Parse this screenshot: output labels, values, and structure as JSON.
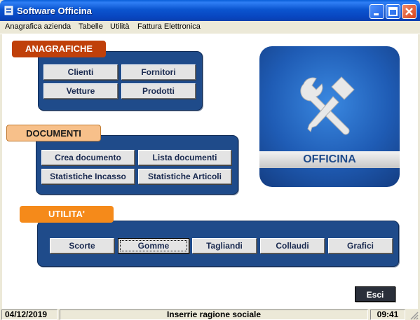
{
  "window": {
    "title": "Software Officina"
  },
  "menu": {
    "items": [
      "Anagrafica azienda",
      "Tabelle",
      "Utilità",
      "Fattura Elettronica"
    ]
  },
  "anagrafiche": {
    "label": "ANAGRAFICHE",
    "buttons": [
      "Clienti",
      "Fornitori",
      "Vetture",
      "Prodotti"
    ]
  },
  "documenti": {
    "label": "DOCUMENTI",
    "buttons": [
      "Crea documento",
      "Lista documenti",
      "Statistiche Incasso",
      "Statistiche Articoli"
    ]
  },
  "utilita": {
    "label": "UTILITA'",
    "buttons": [
      "Scorte",
      "Gomme",
      "Tagliandi",
      "Collaudi",
      "Grafici"
    ]
  },
  "logo": {
    "text": "OFFICINA"
  },
  "exit": {
    "label": "Esci"
  },
  "status": {
    "date": "04/12/2019",
    "message": "Inserrie ragione sociale",
    "time": "09:41"
  },
  "colors": {
    "panel": "#1f4b8a",
    "anagrafiche_label": "#c0400a",
    "documenti_label": "#f7c08a",
    "utilita_label": "#f58a1a"
  }
}
